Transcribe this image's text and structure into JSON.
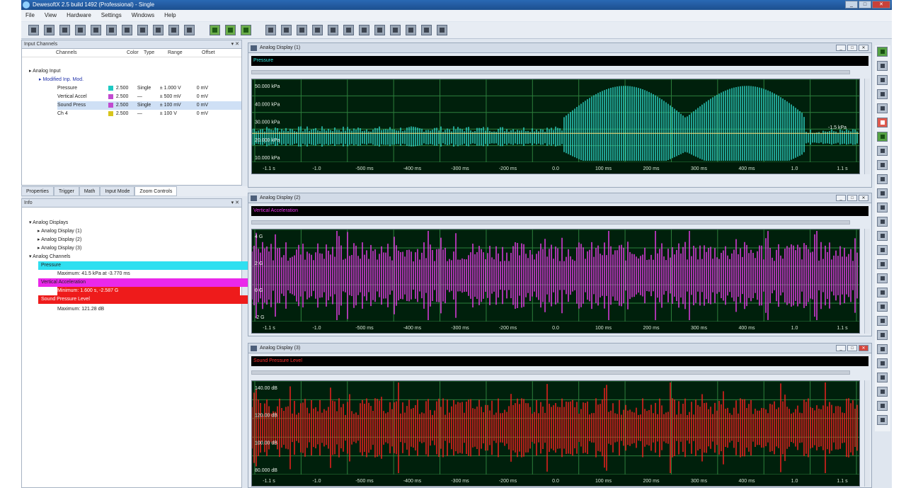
{
  "window": {
    "title": "DewesoftX 2.5 build 1492 (Professional) - Single",
    "controls": {
      "min": "_",
      "max": "□",
      "close": "✕"
    }
  },
  "menu": [
    "File",
    "View",
    "Hardware",
    "Settings",
    "Windows",
    "Help"
  ],
  "input_channels": {
    "title": "Input Channels",
    "pin": "▾ ✕",
    "columns": [
      "Channels",
      "Color",
      "Type",
      "Range",
      "Offset"
    ],
    "tree_root": "Analog Input",
    "tree_group": "Modified Inp. Mod.",
    "rows": [
      {
        "name": "Pressure",
        "color": "#1fc9c3",
        "range": "2.500",
        "type": "Single",
        "range_val": "± 1.000 V",
        "offset": "0 mV"
      },
      {
        "name": "Vertical Accel",
        "color": "#c14bd0",
        "range": "2.500",
        "type": "—",
        "range_val": "± 500 mV",
        "offset": "0 mV"
      },
      {
        "name": "Sound Press",
        "color": "#c14bd0",
        "range": "2.500",
        "type": "Single",
        "range_val": "± 100 mV",
        "offset": "0 mV"
      },
      {
        "name": "Ch 4",
        "color": "#d8c51c",
        "range": "2.500",
        "type": "—",
        "range_val": "± 100 V",
        "offset": "0 mV"
      }
    ]
  },
  "tabs": [
    "Properties",
    "Trigger",
    "Math",
    "Input Mode",
    "Zoom Controls"
  ],
  "info_panel": {
    "title": "Info",
    "pin": "▾ ✕",
    "tree": [
      "Analog Displays",
      "Analog Display (1)",
      "Analog Display (2)",
      "Analog Display (3)",
      "Analog Channels"
    ],
    "channels": [
      {
        "label": "Pressure",
        "bg": "#2fdff0",
        "stat": "Maximum: 41.5 kPa at -3.770 ms"
      },
      {
        "label": "Vertical Acceleration",
        "bg": "#ea28ea",
        "stat": "Minimum: 1.600 s, -2.587 G"
      },
      {
        "label": "Sound Pressure Level",
        "bg": "#ee1b1b",
        "stat": "Maximum: 121.28 dB"
      }
    ]
  },
  "displays": [
    {
      "title": "Analog Display (1)",
      "channel": "Pressure",
      "channel_color": "#2fe0d8",
      "signal_color": "#2fd8cc",
      "yticks": [
        "50.000 kPa",
        "40.000 kPa",
        "30.000 kPa",
        "20.000 kPa",
        "10.000 kPa"
      ],
      "side_label": "-1.5 kPa",
      "xticks": [
        "-1.1 s",
        "-1.0",
        "-500 ms",
        "-400 ms",
        "-300 ms",
        "-200 ms",
        "0.0",
        "100 ms",
        "200 ms",
        "300 ms",
        "400 ms",
        "1.0",
        "1.1 s"
      ]
    },
    {
      "title": "Analog Display (2)",
      "channel": "Vertical Acceleration",
      "channel_color": "#e832e8",
      "signal_color": "#f03cf0",
      "yticks": [
        "4 G",
        "2 G",
        "0 G",
        "-2 G"
      ],
      "side_label": "",
      "xticks": [
        "-1.1 s",
        "-1.0",
        "-500 ms",
        "-400 ms",
        "-300 ms",
        "-200 ms",
        "0.0",
        "100 ms",
        "200 ms",
        "300 ms",
        "400 ms",
        "1.0",
        "1.1 s"
      ]
    },
    {
      "title": "Analog Display (3)",
      "channel": "Sound Pressure Level",
      "channel_color": "#ff3030",
      "signal_color": "#ff2020",
      "yticks": [
        "140.00 dB",
        "120.00 dB",
        "100.00 dB",
        "80.000 dB"
      ],
      "side_label": "",
      "xticks": [
        "-1.1 s",
        "-1.0",
        "-500 ms",
        "-400 ms",
        "-300 ms",
        "-200 ms",
        "0.0",
        "100 ms",
        "200 ms",
        "300 ms",
        "400 ms",
        "1.0",
        "1.1 s"
      ]
    }
  ]
}
